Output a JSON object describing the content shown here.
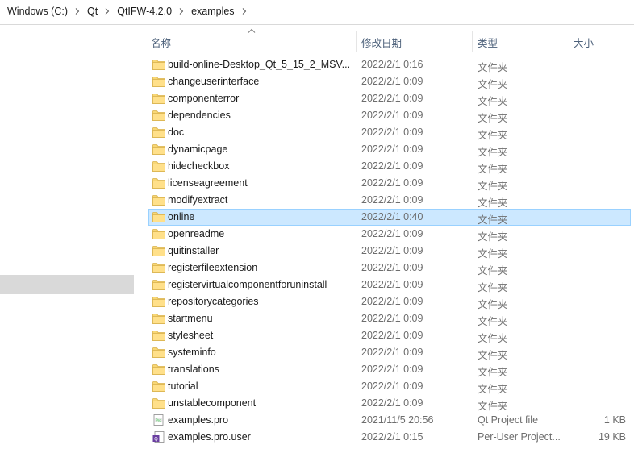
{
  "breadcrumb": {
    "items": [
      "Windows (C:)",
      "Qt",
      "QtIFW-4.2.0",
      "examples"
    ],
    "separator_icon": "chevron-right-icon"
  },
  "columns": {
    "name": "名称",
    "date": "修改日期",
    "type": "类型",
    "size": "大小",
    "sort_icon": "sort-ascending-icon"
  },
  "colors": {
    "selection_bg": "#cce8ff",
    "selection_border": "#99d1ff",
    "folder_yellow": "#f8d775",
    "header_text": "#4c607a"
  },
  "files": [
    {
      "name": "build-online-Desktop_Qt_5_15_2_MSV...",
      "date": "2022/2/1 0:16",
      "type": "文件夹",
      "size": "",
      "icon": "folder-icon"
    },
    {
      "name": "changeuserinterface",
      "date": "2022/2/1 0:09",
      "type": "文件夹",
      "size": "",
      "icon": "folder-icon"
    },
    {
      "name": "componenterror",
      "date": "2022/2/1 0:09",
      "type": "文件夹",
      "size": "",
      "icon": "folder-icon"
    },
    {
      "name": "dependencies",
      "date": "2022/2/1 0:09",
      "type": "文件夹",
      "size": "",
      "icon": "folder-icon"
    },
    {
      "name": "doc",
      "date": "2022/2/1 0:09",
      "type": "文件夹",
      "size": "",
      "icon": "folder-icon"
    },
    {
      "name": "dynamicpage",
      "date": "2022/2/1 0:09",
      "type": "文件夹",
      "size": "",
      "icon": "folder-icon"
    },
    {
      "name": "hidecheckbox",
      "date": "2022/2/1 0:09",
      "type": "文件夹",
      "size": "",
      "icon": "folder-icon"
    },
    {
      "name": "licenseagreement",
      "date": "2022/2/1 0:09",
      "type": "文件夹",
      "size": "",
      "icon": "folder-icon"
    },
    {
      "name": "modifyextract",
      "date": "2022/2/1 0:09",
      "type": "文件夹",
      "size": "",
      "icon": "folder-icon"
    },
    {
      "name": "online",
      "date": "2022/2/1 0:40",
      "type": "文件夹",
      "size": "",
      "icon": "folder-icon",
      "selected": true
    },
    {
      "name": "openreadme",
      "date": "2022/2/1 0:09",
      "type": "文件夹",
      "size": "",
      "icon": "folder-icon"
    },
    {
      "name": "quitinstaller",
      "date": "2022/2/1 0:09",
      "type": "文件夹",
      "size": "",
      "icon": "folder-icon"
    },
    {
      "name": "registerfileextension",
      "date": "2022/2/1 0:09",
      "type": "文件夹",
      "size": "",
      "icon": "folder-icon"
    },
    {
      "name": "registervirtualcomponentforuninstall",
      "date": "2022/2/1 0:09",
      "type": "文件夹",
      "size": "",
      "icon": "folder-icon"
    },
    {
      "name": "repositorycategories",
      "date": "2022/2/1 0:09",
      "type": "文件夹",
      "size": "",
      "icon": "folder-icon"
    },
    {
      "name": "startmenu",
      "date": "2022/2/1 0:09",
      "type": "文件夹",
      "size": "",
      "icon": "folder-icon"
    },
    {
      "name": "stylesheet",
      "date": "2022/2/1 0:09",
      "type": "文件夹",
      "size": "",
      "icon": "folder-icon"
    },
    {
      "name": "systeminfo",
      "date": "2022/2/1 0:09",
      "type": "文件夹",
      "size": "",
      "icon": "folder-icon"
    },
    {
      "name": "translations",
      "date": "2022/2/1 0:09",
      "type": "文件夹",
      "size": "",
      "icon": "folder-icon"
    },
    {
      "name": "tutorial",
      "date": "2022/2/1 0:09",
      "type": "文件夹",
      "size": "",
      "icon": "folder-icon"
    },
    {
      "name": "unstablecomponent",
      "date": "2022/2/1 0:09",
      "type": "文件夹",
      "size": "",
      "icon": "folder-icon"
    },
    {
      "name": "examples.pro",
      "date": "2021/11/5 20:56",
      "type": "Qt Project file",
      "size": "1 KB",
      "icon": "qt-project-file-icon"
    },
    {
      "name": "examples.pro.user",
      "date": "2022/2/1 0:15",
      "type": "Per-User Project...",
      "size": "19 KB",
      "icon": "qt-creator-user-file-icon"
    }
  ]
}
